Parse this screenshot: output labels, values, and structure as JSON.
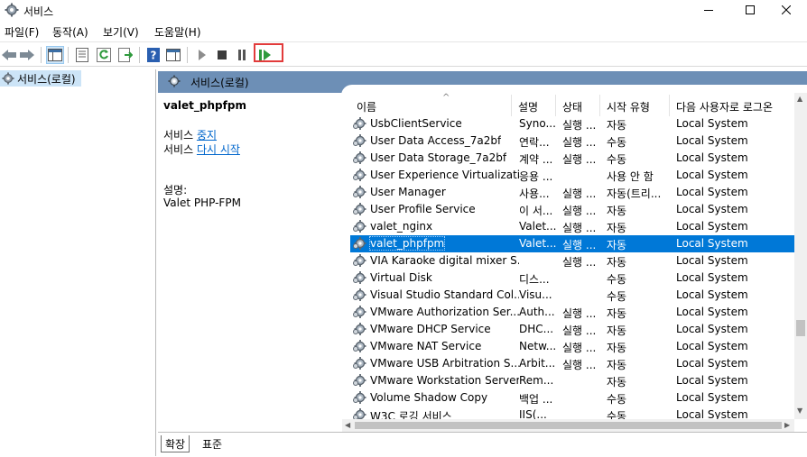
{
  "window": {
    "title": "서비스",
    "icon": "gear-icon",
    "buttons": [
      "minimize-icon",
      "maximize-icon",
      "close-icon"
    ]
  },
  "menu": [
    "파일(F)",
    "동작(A)",
    "보기(V)",
    "도움말(H)"
  ],
  "toolbar": {
    "buttons": [
      "back-arrow-icon",
      "forward-arrow-icon",
      "show-hide-tree-icon",
      "properties-icon",
      "refresh-icon",
      "export-list-icon",
      "help-icon",
      "show-hide-action-pane-icon",
      "start-icon",
      "stop-icon",
      "pause-icon",
      "resume-icon"
    ],
    "highlighted": "resume-icon",
    "highlight_color": "#e23b3b"
  },
  "tree": {
    "item_label": "서비스(로컬)"
  },
  "header": {
    "label": "서비스(로컬)",
    "color": "#6d8fb6"
  },
  "desc": {
    "service_name": "valet_phpfpm",
    "line1_prefix": "서비스 ",
    "stop_link": "중지",
    "line2_prefix": "서비스 ",
    "restart_link": "다시 시작",
    "desc_label": "설명:",
    "desc_text": "Valet PHP-FPM"
  },
  "columns": [
    "이름",
    "설명",
    "상태",
    "시작 유형",
    "다음 사용자로 로그온"
  ],
  "rows": [
    {
      "name": "UsbClientService",
      "desc": "Syno...",
      "status": "실행 ...",
      "startup": "자동",
      "logon": "Local System"
    },
    {
      "name": "User Data Access_7a2bf",
      "desc": "연락...",
      "status": "실행 ...",
      "startup": "수동",
      "logon": "Local System"
    },
    {
      "name": "User Data Storage_7a2bf",
      "desc": "계약 ...",
      "status": "실행 ...",
      "startup": "수동",
      "logon": "Local System"
    },
    {
      "name": "User Experience Virtualizati...",
      "desc": "응용 ...",
      "status": "",
      "startup": "사용 안 함",
      "logon": "Local System"
    },
    {
      "name": "User Manager",
      "desc": "사용...",
      "status": "실행 ...",
      "startup": "자동(트리...",
      "logon": "Local System"
    },
    {
      "name": "User Profile Service",
      "desc": "이 서...",
      "status": "실행 ...",
      "startup": "자동",
      "logon": "Local System"
    },
    {
      "name": "valet_nginx",
      "desc": "Valet...",
      "status": "실행 ...",
      "startup": "자동",
      "logon": "Local System"
    },
    {
      "name": "valet_phpfpm",
      "desc": "Valet...",
      "status": "실행 ...",
      "startup": "자동",
      "logon": "Local System",
      "selected": true
    },
    {
      "name": "VIA Karaoke digital mixer S...",
      "desc": "",
      "status": "실행 ...",
      "startup": "자동",
      "logon": "Local System"
    },
    {
      "name": "Virtual Disk",
      "desc": "디스...",
      "status": "",
      "startup": "수동",
      "logon": "Local System"
    },
    {
      "name": "Visual Studio Standard Col...",
      "desc": "Visu...",
      "status": "",
      "startup": "수동",
      "logon": "Local System"
    },
    {
      "name": "VMware Authorization Ser...",
      "desc": "Auth...",
      "status": "실행 ...",
      "startup": "자동",
      "logon": "Local System"
    },
    {
      "name": "VMware DHCP Service",
      "desc": "DHC...",
      "status": "실행 ...",
      "startup": "자동",
      "logon": "Local System"
    },
    {
      "name": "VMware NAT Service",
      "desc": "Netw...",
      "status": "실행 ...",
      "startup": "자동",
      "logon": "Local System"
    },
    {
      "name": "VMware USB Arbitration S...",
      "desc": "Arbit...",
      "status": "실행 ...",
      "startup": "자동",
      "logon": "Local System"
    },
    {
      "name": "VMware Workstation Server",
      "desc": "Rem...",
      "status": "",
      "startup": "자동",
      "logon": "Local System"
    },
    {
      "name": "Volume Shadow Copy",
      "desc": "백업 ...",
      "status": "",
      "startup": "수동",
      "logon": "Local System"
    },
    {
      "name": "W3C 로깅 서비스",
      "desc": "IIS(...",
      "status": "",
      "startup": "수동",
      "logon": "Local System"
    }
  ],
  "tabs": [
    "확장",
    "표준"
  ],
  "colors": {
    "selection": "#0078d7",
    "tree_selection": "#cce4f7",
    "link": "#0066cc"
  }
}
